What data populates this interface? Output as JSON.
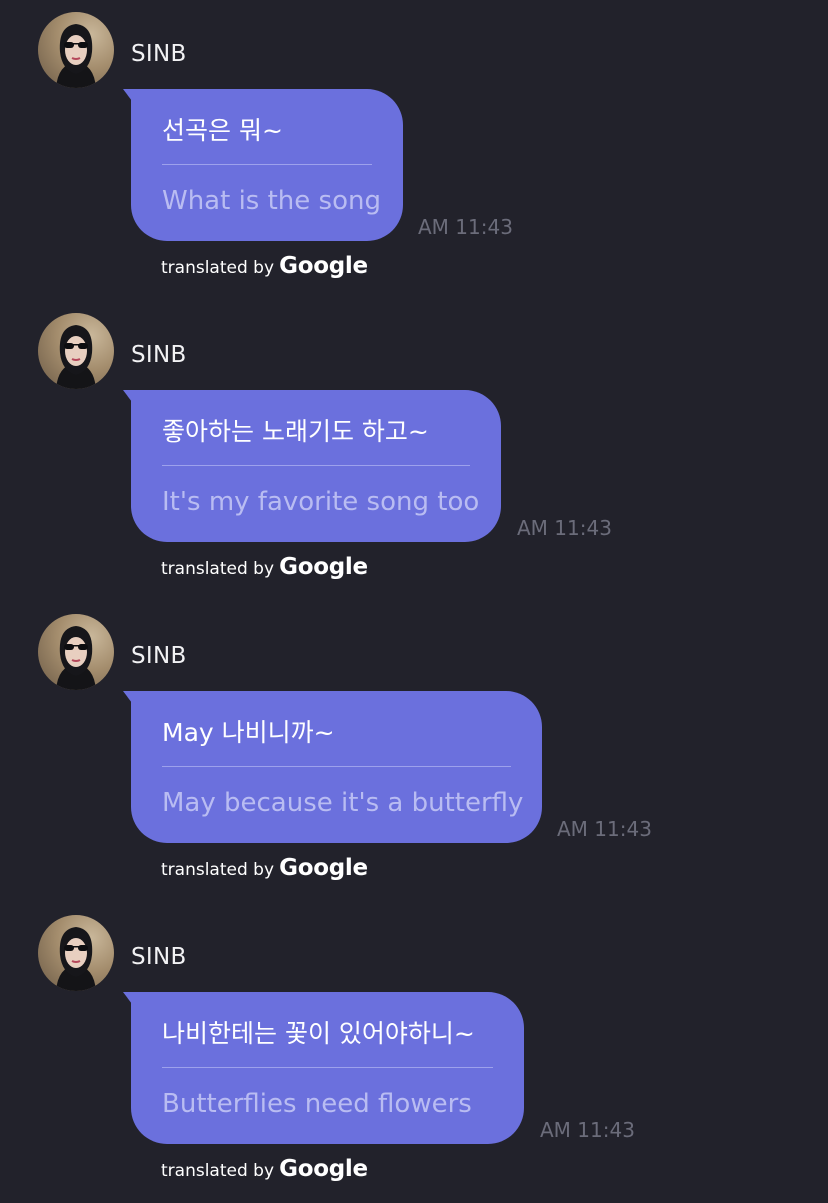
{
  "messages": [
    {
      "sender": "SINB",
      "original": "선곡은 뭐~",
      "translation": "What is the song",
      "time": "AM 11:43",
      "credit_label": "translated by",
      "credit_brand": "Google"
    },
    {
      "sender": "SINB",
      "original": "좋아하는 노래기도 하고~",
      "translation": "It's my favorite song too",
      "time": "AM 11:43",
      "credit_label": "translated by",
      "credit_brand": "Google"
    },
    {
      "sender": "SINB",
      "original": "May 나비니까~",
      "translation": "May because it's a butterfly",
      "time": "AM 11:43",
      "credit_label": "translated by",
      "credit_brand": "Google"
    },
    {
      "sender": "SINB",
      "original": "나비한테는 꽃이 있어야하니~",
      "translation": "Butterflies need flowers",
      "time": "AM 11:43",
      "credit_label": "translated by",
      "credit_brand": "Google"
    }
  ],
  "colors": {
    "background": "#22222b",
    "bubble": "#6b70dd",
    "translation_text": "#b9bcf2",
    "timestamp": "#6b6c7a"
  },
  "icons": {
    "avatar": "profile-photo-avatar"
  }
}
